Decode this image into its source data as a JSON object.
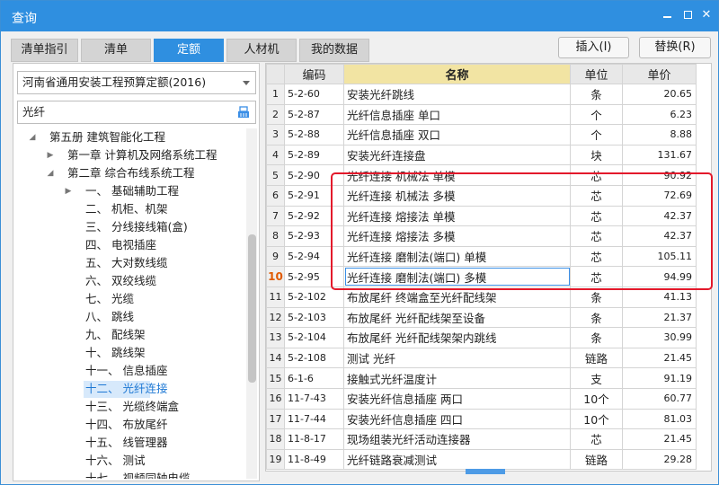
{
  "window": {
    "title": "查询",
    "title_color": "#2f8fe0",
    "controls": [
      "minimize-icon",
      "maximize-icon",
      "close-icon"
    ],
    "close_glyph": "✕"
  },
  "tabs": [
    {
      "label": "清单指引",
      "active": false
    },
    {
      "label": "清单",
      "active": false
    },
    {
      "label": "定额",
      "active": true
    },
    {
      "label": "人材机",
      "active": false
    },
    {
      "label": "我的数据",
      "active": false
    }
  ],
  "actions": {
    "insert_label": "插入(I)",
    "replace_label": "替换(R)"
  },
  "left": {
    "library_select": "河南省通用安装工程预算定额(2016)",
    "search_value": "光纤",
    "tree": [
      {
        "label": "第五册 建筑智能化工程",
        "level": 0,
        "caret": "down"
      },
      {
        "label": "第一章 计算机及网络系统工程",
        "level": 1,
        "caret": "right"
      },
      {
        "label": "第二章 综合布线系统工程",
        "level": 1,
        "caret": "down"
      },
      {
        "label": "一、 基础辅助工程",
        "level": 2,
        "caret": "right"
      },
      {
        "label": "二、 机柜、机架",
        "level": 2,
        "caret": ""
      },
      {
        "label": "三、 分线接线箱(盒)",
        "level": 2,
        "caret": ""
      },
      {
        "label": "四、 电视插座",
        "level": 2,
        "caret": ""
      },
      {
        "label": "五、 大对数线缆",
        "level": 2,
        "caret": ""
      },
      {
        "label": "六、 双绞线缆",
        "level": 2,
        "caret": ""
      },
      {
        "label": "七、 光缆",
        "level": 2,
        "caret": ""
      },
      {
        "label": "八、 跳线",
        "level": 2,
        "caret": ""
      },
      {
        "label": "九、 配线架",
        "level": 2,
        "caret": ""
      },
      {
        "label": "十、 跳线架",
        "level": 2,
        "caret": ""
      },
      {
        "label": "十一、 信息插座",
        "level": 2,
        "caret": ""
      },
      {
        "label": "十二、 光纤连接",
        "level": 2,
        "caret": "",
        "selected": true
      },
      {
        "label": "十三、 光缆终端盒",
        "level": 2,
        "caret": ""
      },
      {
        "label": "十四、 布放尾纤",
        "level": 2,
        "caret": ""
      },
      {
        "label": "十五、 线管理器",
        "level": 2,
        "caret": ""
      },
      {
        "label": "十六、 测试",
        "level": 2,
        "caret": ""
      },
      {
        "label": "十七、 视频同轴电缆",
        "level": 2,
        "caret": ""
      }
    ]
  },
  "table": {
    "headers": {
      "code": "编码",
      "name": "名称",
      "unit": "单位",
      "price": "单价"
    },
    "current_row": 10,
    "highlight_color": "#e3192b",
    "highlighted_rows": [
      5,
      6,
      7,
      8,
      9,
      10
    ],
    "rows": [
      {
        "n": "1",
        "code": "5-2-60",
        "name": "安装光纤跳线",
        "unit": "条",
        "price": "20.65"
      },
      {
        "n": "2",
        "code": "5-2-87",
        "name": "光纤信息插座 单口",
        "unit": "个",
        "price": "6.23"
      },
      {
        "n": "3",
        "code": "5-2-88",
        "name": "光纤信息插座 双口",
        "unit": "个",
        "price": "8.88"
      },
      {
        "n": "4",
        "code": "5-2-89",
        "name": "安装光纤连接盘",
        "unit": "块",
        "price": "131.67"
      },
      {
        "n": "5",
        "code": "5-2-90",
        "name": "光纤连接 机械法 单模",
        "unit": "芯",
        "price": "90.92"
      },
      {
        "n": "6",
        "code": "5-2-91",
        "name": "光纤连接 机械法 多模",
        "unit": "芯",
        "price": "72.69"
      },
      {
        "n": "7",
        "code": "5-2-92",
        "name": "光纤连接 熔接法 单模",
        "unit": "芯",
        "price": "42.37"
      },
      {
        "n": "8",
        "code": "5-2-93",
        "name": "光纤连接 熔接法 多模",
        "unit": "芯",
        "price": "42.37"
      },
      {
        "n": "9",
        "code": "5-2-94",
        "name": "光纤连接 磨制法(端口) 单模",
        "unit": "芯",
        "price": "105.11"
      },
      {
        "n": "10",
        "code": "5-2-95",
        "name": "光纤连接 磨制法(端口) 多模",
        "unit": "芯",
        "price": "94.99"
      },
      {
        "n": "11",
        "code": "5-2-102",
        "name": "布放尾纤 终端盒至光纤配线架",
        "unit": "条",
        "price": "41.13"
      },
      {
        "n": "12",
        "code": "5-2-103",
        "name": "布放尾纤 光纤配线架至设备",
        "unit": "条",
        "price": "21.37"
      },
      {
        "n": "13",
        "code": "5-2-104",
        "name": "布放尾纤 光纤配线架架内跳线",
        "unit": "条",
        "price": "30.99"
      },
      {
        "n": "14",
        "code": "5-2-108",
        "name": "测试 光纤",
        "unit": "链路",
        "price": "21.45"
      },
      {
        "n": "15",
        "code": "6-1-6",
        "name": "接触式光纤温度计",
        "unit": "支",
        "price": "91.19"
      },
      {
        "n": "16",
        "code": "11-7-43",
        "name": "安装光纤信息插座 两口",
        "unit": "10个",
        "price": "60.77"
      },
      {
        "n": "17",
        "code": "11-7-44",
        "name": "安装光纤信息插座 四口",
        "unit": "10个",
        "price": "81.03"
      },
      {
        "n": "18",
        "code": "11-8-17",
        "name": "现场组装光纤活动连接器",
        "unit": "芯",
        "price": "21.45"
      },
      {
        "n": "19",
        "code": "11-8-49",
        "name": "光纤链路衰减测试",
        "unit": "链路",
        "price": "29.28"
      }
    ]
  }
}
